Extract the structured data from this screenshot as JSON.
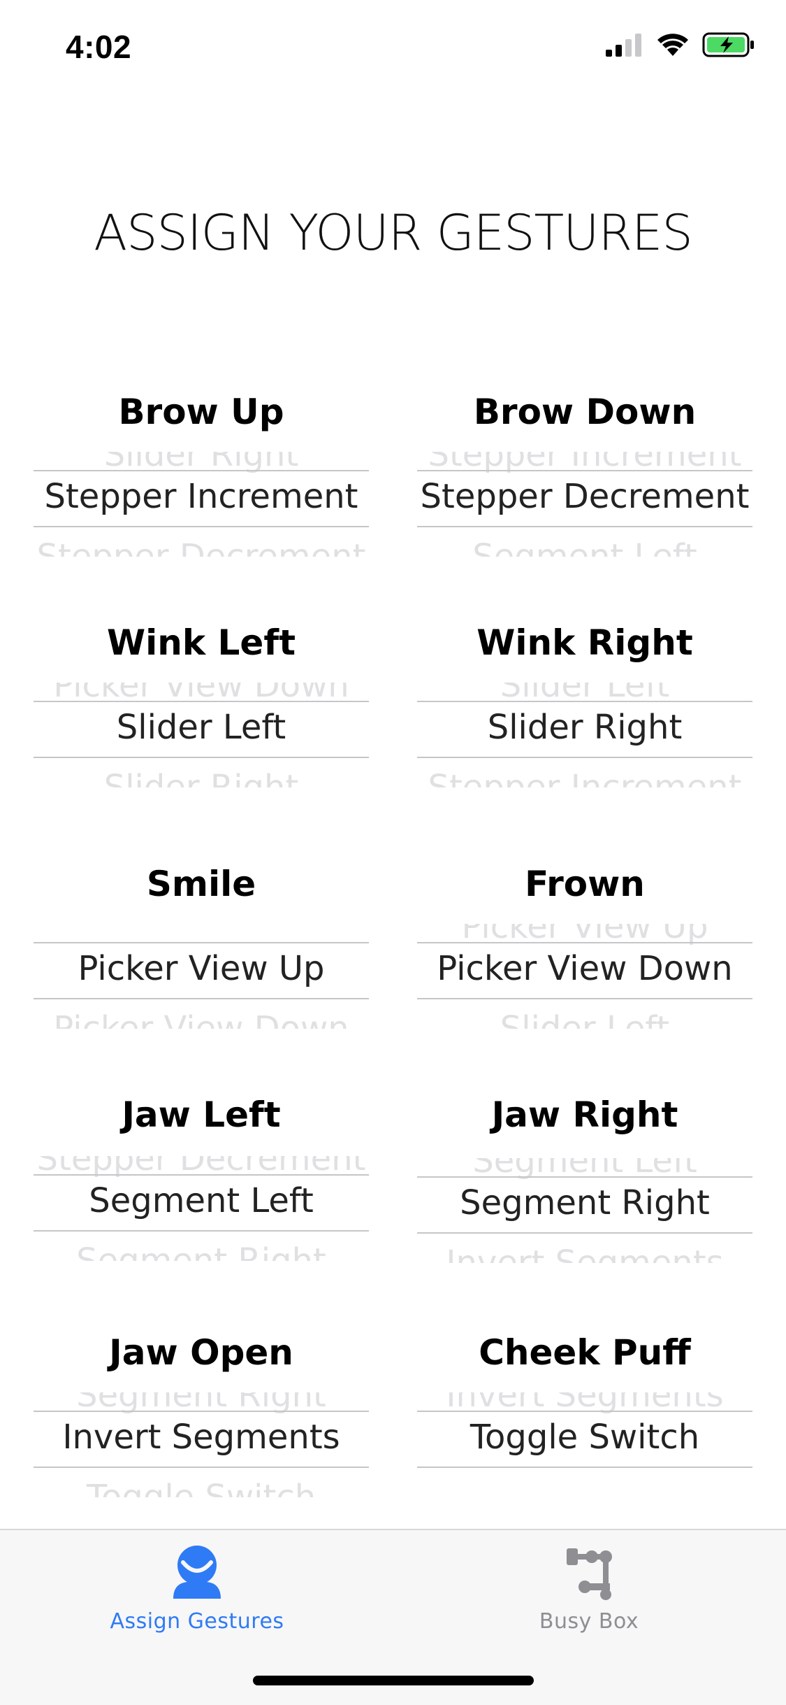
{
  "status_bar": {
    "time": "4:02",
    "icons": [
      "cellular-signal-icon",
      "wifi-icon",
      "battery-charging-icon"
    ]
  },
  "title": "ASSIGN YOUR GESTURES",
  "gestures": [
    {
      "name": "Brow Up",
      "above": "Slider Right",
      "selected": "Stepper Increment",
      "below": "Stepper Decrement"
    },
    {
      "name": "Brow Down",
      "above": "Stepper Increment",
      "selected": "Stepper Decrement",
      "below": "Segment Left"
    },
    {
      "name": "Wink Left",
      "above": "Picker View Down",
      "selected": "Slider Left",
      "below": "Slider Right"
    },
    {
      "name": "Wink Right",
      "above": "Slider Left",
      "selected": "Slider Right",
      "below": "Stepper Increment"
    },
    {
      "name": "Smile",
      "above": "",
      "selected": "Picker View Up",
      "below": "Picker View Down"
    },
    {
      "name": "Frown",
      "above": "Picker View Up",
      "selected": "Picker View Down",
      "below": "Slider Left"
    },
    {
      "name": "Jaw Left",
      "above": "Stepper Decrement",
      "selected": "Segment Left",
      "below": "Segment Right"
    },
    {
      "name": "Jaw Right",
      "above": "Segment Left",
      "selected": "Segment Right",
      "below": "Invert Segments"
    },
    {
      "name": "Jaw Open",
      "above": "Segment Right",
      "selected": "Invert Segments",
      "below": "Toggle Switch"
    },
    {
      "name": "Cheek Puff",
      "above": "Invert Segments",
      "selected": "Toggle Switch",
      "below": ""
    }
  ],
  "tab_bar": {
    "tabs": [
      {
        "label": "Assign Gestures",
        "icon": "person-icon",
        "active": true
      },
      {
        "label": "Busy Box",
        "icon": "controls-icon",
        "active": false
      }
    ],
    "active_color": "#2f7bf5",
    "inactive_color": "#8e8e93"
  }
}
